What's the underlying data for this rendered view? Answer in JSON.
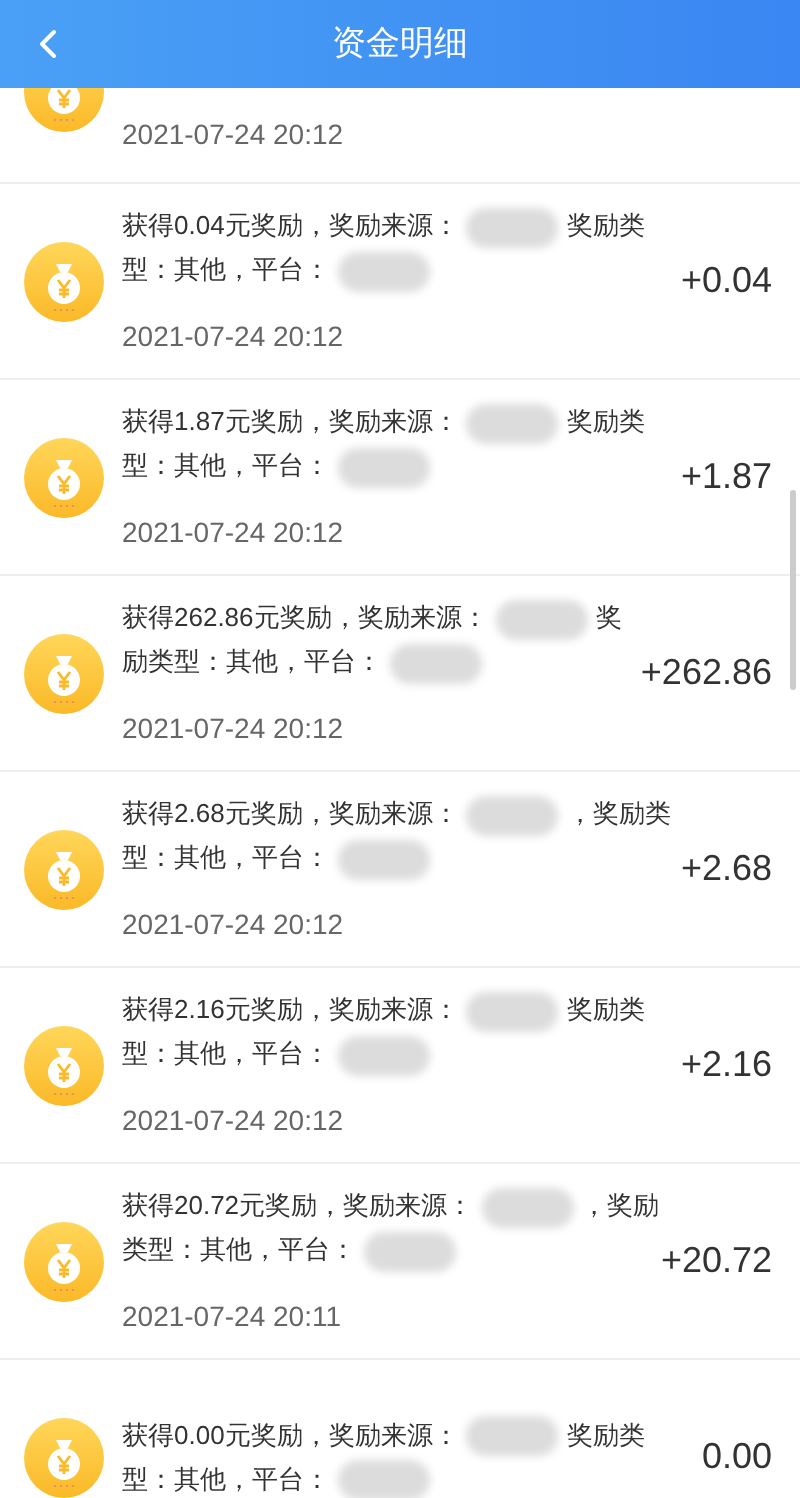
{
  "header": {
    "title": "资金明细"
  },
  "partial_record": {
    "time": "2021-07-24 20:12"
  },
  "records": [
    {
      "description": [
        {
          "kind": "text",
          "text": "获得0.04元奖励，奖励来源："
        },
        {
          "kind": "blur"
        },
        {
          "kind": "text",
          "text": "奖励类型：其他，平台："
        },
        {
          "kind": "blur"
        }
      ],
      "time": "2021-07-24 20:12",
      "amount": "+0.04"
    },
    {
      "description": [
        {
          "kind": "text",
          "text": "获得1.87元奖励，奖励来源："
        },
        {
          "kind": "blur"
        },
        {
          "kind": "text",
          "text": "奖励类型：其他，平台："
        },
        {
          "kind": "blur"
        }
      ],
      "time": "2021-07-24 20:12",
      "amount": "+1.87"
    },
    {
      "description": [
        {
          "kind": "text",
          "text": "获得262.86元奖励，奖励来源："
        },
        {
          "kind": "blur"
        },
        {
          "kind": "text",
          "text": "奖励类型：其他，平台："
        },
        {
          "kind": "blur"
        }
      ],
      "time": "2021-07-24 20:12",
      "amount": "+262.86"
    },
    {
      "description": [
        {
          "kind": "text",
          "text": "获得2.68元奖励，奖励来源："
        },
        {
          "kind": "blur"
        },
        {
          "kind": "text",
          "text": "，奖励类型：其他，平台："
        },
        {
          "kind": "blur"
        }
      ],
      "time": "2021-07-24 20:12",
      "amount": "+2.68"
    },
    {
      "description": [
        {
          "kind": "text",
          "text": "获得2.16元奖励，奖励来源："
        },
        {
          "kind": "blur"
        },
        {
          "kind": "text",
          "text": "奖励类型：其他，平台："
        },
        {
          "kind": "blur"
        }
      ],
      "time": "2021-07-24 20:12",
      "amount": "+2.16"
    },
    {
      "description": [
        {
          "kind": "text",
          "text": "获得20.72元奖励，奖励来源："
        },
        {
          "kind": "blur"
        },
        {
          "kind": "text",
          "text": "，奖励类型：其他，平台："
        },
        {
          "kind": "blur"
        }
      ],
      "time": "2021-07-24 20:11",
      "amount": "+20.72"
    },
    {
      "description": [
        {
          "kind": "text",
          "text": "获得0.00元奖励，奖励来源："
        },
        {
          "kind": "blur"
        },
        {
          "kind": "text",
          "text": "奖励类型：其他，平台："
        },
        {
          "kind": "blur"
        }
      ],
      "amount": "0.00"
    }
  ]
}
